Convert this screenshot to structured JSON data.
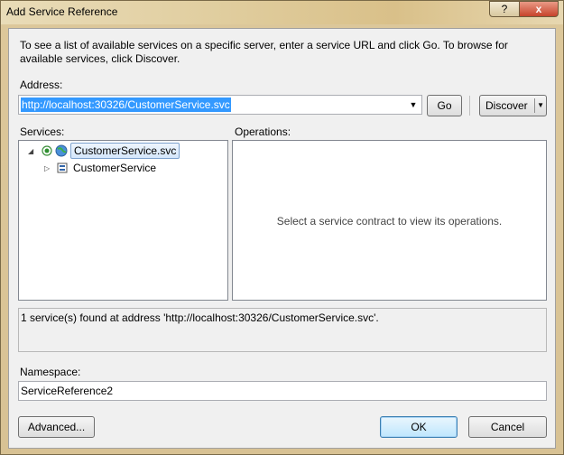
{
  "window": {
    "title": "Add Service Reference",
    "help_label": "?",
    "close_label": "x"
  },
  "intro_text": "To see a list of available services on a specific server, enter a service URL and click Go. To browse for available services, click Discover.",
  "address": {
    "label": "Address:",
    "value": "http://localhost:30326/CustomerService.svc"
  },
  "buttons": {
    "go": "Go",
    "discover": "Discover",
    "advanced": "Advanced...",
    "ok": "OK",
    "cancel": "Cancel"
  },
  "services": {
    "label": "Services:",
    "items": [
      {
        "label": "CustomerService.svc",
        "expanded": true,
        "selected": true
      },
      {
        "label": "CustomerService",
        "expanded": false,
        "selected": false
      }
    ]
  },
  "operations": {
    "label": "Operations:",
    "empty_message": "Select a service contract to view its operations."
  },
  "status_text": "1 service(s) found at address 'http://localhost:30326/CustomerService.svc'.",
  "namespace": {
    "label": "Namespace:",
    "value": "ServiceReference2"
  }
}
